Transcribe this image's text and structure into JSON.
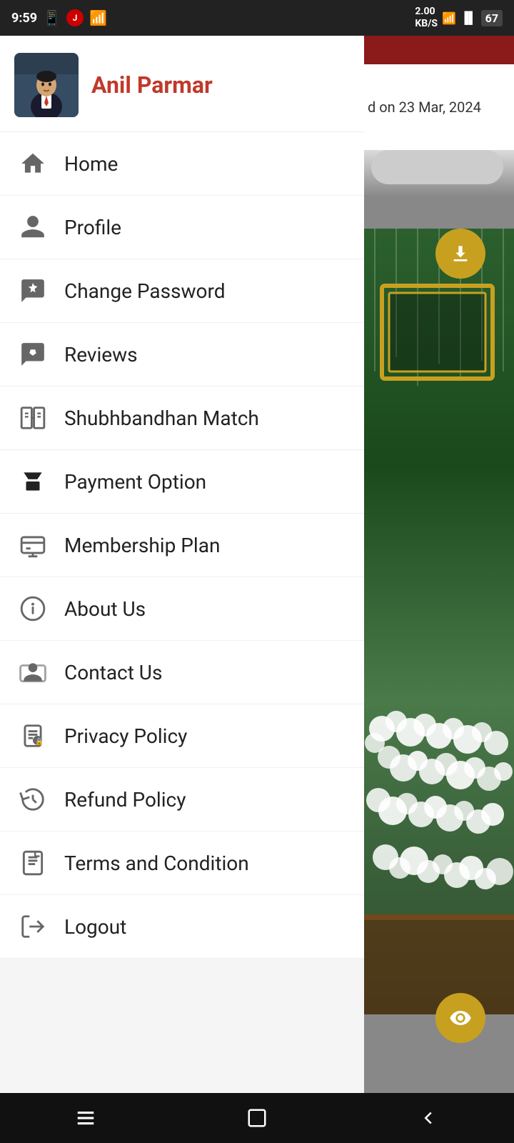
{
  "statusBar": {
    "time": "9:59",
    "network": "2.00\nKB/S",
    "battery": "67"
  },
  "drawer": {
    "userName": "Anil Parmar",
    "menuItems": [
      {
        "id": "home",
        "label": "Home",
        "icon": "home"
      },
      {
        "id": "profile",
        "label": "Profile",
        "icon": "person"
      },
      {
        "id": "change-password",
        "label": "Change Password",
        "icon": "chat-star"
      },
      {
        "id": "reviews",
        "label": "Reviews",
        "icon": "chat-star-2"
      },
      {
        "id": "shubhbandhan-match",
        "label": "Shubhbandhan Match",
        "icon": "match"
      },
      {
        "id": "payment-option",
        "label": "Payment Option",
        "icon": "bookmark"
      },
      {
        "id": "membership-plan",
        "label": "Membership Plan",
        "icon": "monitor"
      },
      {
        "id": "about-us",
        "label": "About Us",
        "icon": "info"
      },
      {
        "id": "contact-us",
        "label": "Contact Us",
        "icon": "contact"
      },
      {
        "id": "privacy-policy",
        "label": "Privacy Policy",
        "icon": "privacy"
      },
      {
        "id": "refund-policy",
        "label": "Refund Policy",
        "icon": "refund"
      },
      {
        "id": "terms-condition",
        "label": "Terms and Condition",
        "icon": "terms"
      },
      {
        "id": "logout",
        "label": "Logout",
        "icon": "logout"
      }
    ]
  },
  "bgRight": {
    "dateText": "d on 23 Mar, 2024"
  },
  "bottomNav": {
    "icons": [
      "menu",
      "square",
      "triangle"
    ]
  }
}
